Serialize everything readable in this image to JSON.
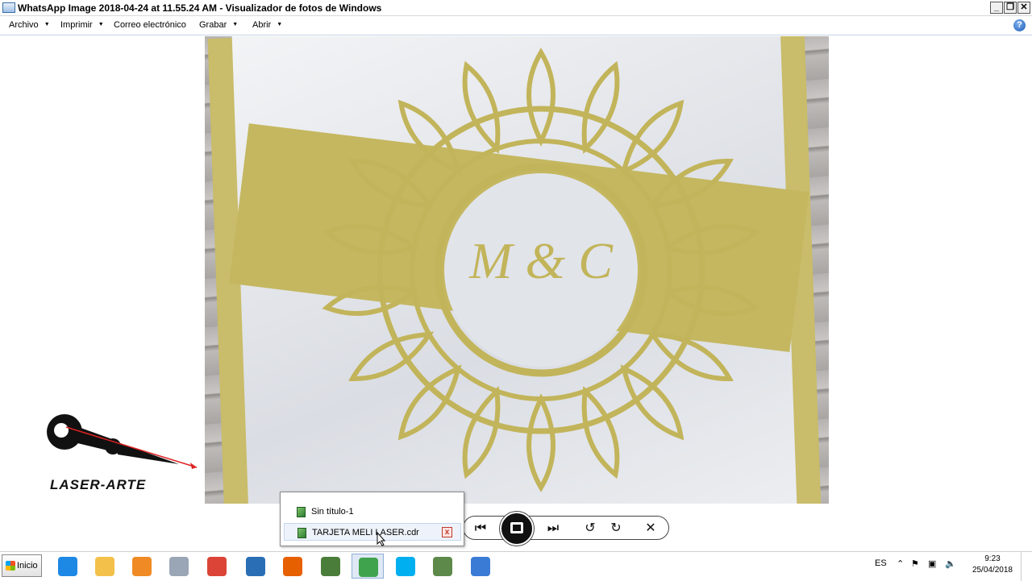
{
  "window": {
    "title": "WhatsApp Image 2018-04-24 at 11.55.24 AM - Visualizador de fotos de Windows",
    "minimize": "_",
    "restore": "❐",
    "close": "✕"
  },
  "menu": {
    "items": [
      "Archivo",
      "Imprimir",
      "Correo electrónico",
      "Grabar",
      "Abrir"
    ],
    "help": "?"
  },
  "photo": {
    "monogram": "M & C"
  },
  "logo": {
    "text": "LASER-ARTE"
  },
  "controls": {
    "prev": "⏮",
    "next": "⏭",
    "rotate_left": "↺",
    "rotate_right": "↻",
    "delete": "✕"
  },
  "jumplist": {
    "items": [
      "Sin título-1",
      "TARJETA MELI LASER.cdr"
    ],
    "close": "x"
  },
  "taskbar": {
    "start": "Inicio",
    "apps": [
      {
        "icon": "internet-explorer-icon",
        "color": "#1e88e5"
      },
      {
        "icon": "file-explorer-icon",
        "color": "#f3c14a"
      },
      {
        "icon": "media-player-icon",
        "color": "#f08a24"
      },
      {
        "icon": "calculator-icon",
        "color": "#9aa6b5"
      },
      {
        "icon": "chrome-icon",
        "color": "#db4437"
      },
      {
        "icon": "network-icon",
        "color": "#2a6fb5"
      },
      {
        "icon": "firefox-icon",
        "color": "#e66000"
      },
      {
        "icon": "corel-capture-icon",
        "color": "#4a7d3a"
      },
      {
        "icon": "coreldraw-icon",
        "color": "#3fa34d"
      },
      {
        "icon": "skype-icon",
        "color": "#00aff0"
      },
      {
        "icon": "corel-photo-icon",
        "color": "#5d8a4a"
      },
      {
        "icon": "photo-viewer-icon",
        "color": "#3a7bd5"
      }
    ],
    "language": "ES",
    "time": "9:23",
    "date": "25/04/2018"
  }
}
